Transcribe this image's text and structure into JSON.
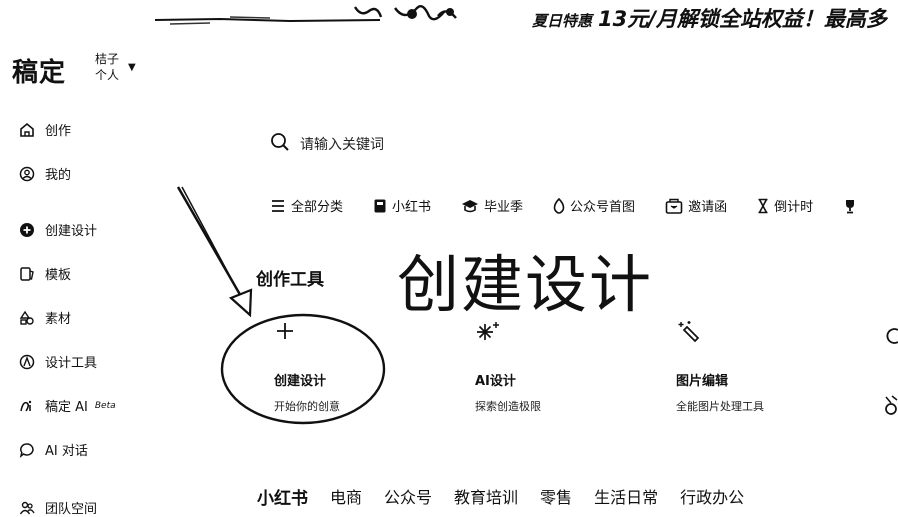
{
  "banner": {
    "promo_tag": "夏日特惠",
    "promo_text": "13元/月解锁全站权益！最高多"
  },
  "brand": {
    "logo": "稿定",
    "account_line1": "桔子",
    "account_line2": "个人"
  },
  "sidebar": {
    "items": [
      {
        "label": "创作",
        "icon": "home-icon"
      },
      {
        "label": "我的",
        "icon": "user-icon"
      },
      {
        "label": "创建设计",
        "icon": "plus-circle-icon"
      },
      {
        "label": "模板",
        "icon": "template-icon"
      },
      {
        "label": "素材",
        "icon": "material-icon"
      },
      {
        "label": "设计工具",
        "icon": "design-tool-icon"
      },
      {
        "label": "稿定 AI",
        "badge": "Beta",
        "icon": "ai-icon"
      },
      {
        "label": "AI 对话",
        "icon": "chat-icon"
      },
      {
        "label": "团队空间",
        "icon": "team-icon"
      }
    ]
  },
  "search": {
    "placeholder": "请输入关键词",
    "icon": "search-icon"
  },
  "categories": [
    {
      "label": "全部分类",
      "icon": "menu-icon"
    },
    {
      "label": "小红书",
      "icon": "book-icon"
    },
    {
      "label": "毕业季",
      "icon": "graduation-cap-icon"
    },
    {
      "label": "公众号首图",
      "icon": "flame-icon"
    },
    {
      "label": "邀请函",
      "icon": "invitation-icon"
    },
    {
      "label": "倒计时",
      "icon": "hourglass-icon"
    }
  ],
  "tools": {
    "title": "创作工具",
    "items": [
      {
        "name": "创建设计",
        "desc": "开始你的创意"
      },
      {
        "name": "AI设计",
        "desc": "探索创造极限"
      },
      {
        "name": "图片编辑",
        "desc": "全能图片处理工具"
      }
    ]
  },
  "annotation": {
    "big_title": "创建设计"
  },
  "tabs": [
    "小红书",
    "电商",
    "公众号",
    "教育培训",
    "零售",
    "生活日常",
    "行政办公"
  ]
}
